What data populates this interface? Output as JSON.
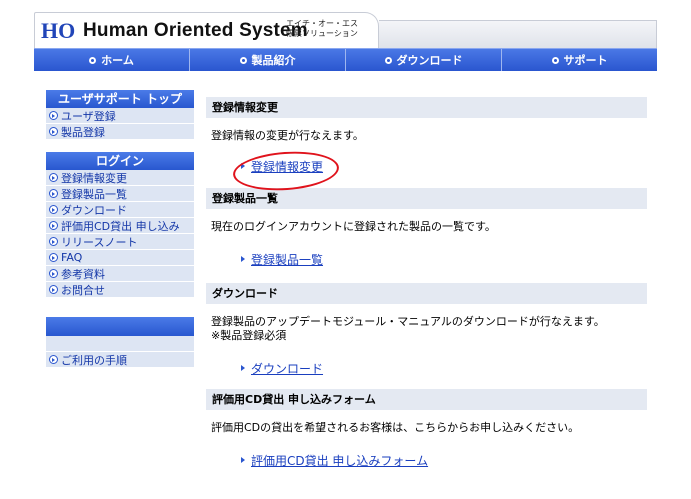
{
  "header": {
    "logo_letters": "HOS",
    "brand": "Human Oriented System",
    "brand_sub_line1": "エイチ・オー・エス",
    "brand_sub_line2": "帳票ソリューション"
  },
  "nav": [
    {
      "label": "ホーム"
    },
    {
      "label": "製品紹介"
    },
    {
      "label": "ダウンロード"
    },
    {
      "label": "サポート"
    }
  ],
  "sidebar": {
    "group1_title": "ユーザサポート トップ",
    "group1_items": [
      "ユーザ登録",
      "製品登録"
    ],
    "group2_title": "ログイン",
    "group2_items": [
      "登録情報変更",
      "登録製品一覧",
      "ダウンロード",
      "評価用CD貸出 申し込み",
      "リリースノート",
      "FAQ",
      "参考資料",
      "お問合せ"
    ],
    "group3_items": [
      "ご利用の手順"
    ]
  },
  "main": {
    "sections": [
      {
        "title": "登録情報変更",
        "desc": "登録情報の変更が行なえます。",
        "desc2": "",
        "link": "登録情報変更"
      },
      {
        "title": "登録製品一覧",
        "desc": "現在のログインアカウントに登録された製品の一覧です。",
        "desc2": "",
        "link": "登録製品一覧"
      },
      {
        "title": "ダウンロード",
        "desc": "登録製品のアップデートモジュール・マニュアルのダウンロードが行なえます。",
        "desc2": "※製品登録必須",
        "link": "ダウンロード"
      },
      {
        "title": "評価用CD貸出 申し込みフォーム",
        "desc": "評価用CDの貸出を希望されるお客様は、こちらからお申し込みください。",
        "desc2": "",
        "link": "評価用CD貸出 申し込みフォーム"
      }
    ]
  },
  "colors": {
    "nav_blue": "#2e5fd9",
    "link_blue": "#1a3fbf",
    "highlight_circle": "#e0131c"
  }
}
